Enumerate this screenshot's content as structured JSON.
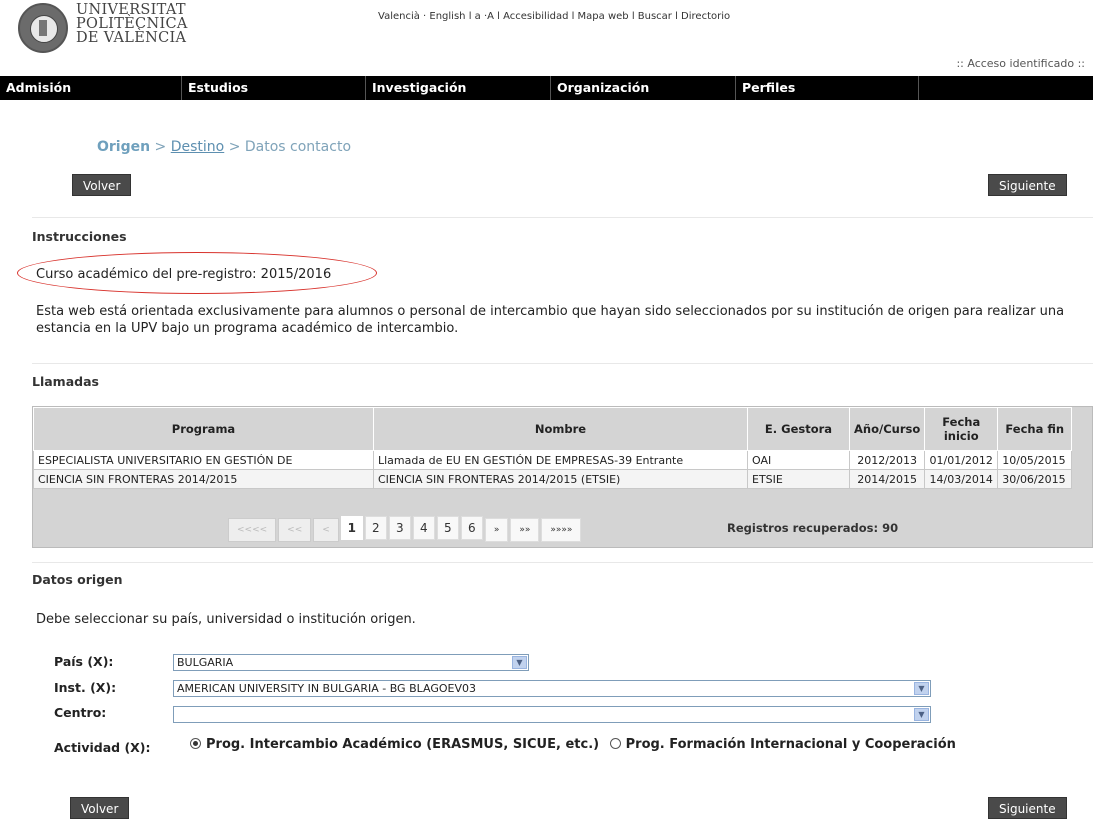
{
  "header": {
    "logo_lines": [
      "UNIVERSITAT",
      "POLITÈCNICA",
      "DE VALÈNCIA"
    ],
    "top_links": "Valencià · English l  a ·A  l  Accesibilidad  l  Mapa web  l  Buscar  l  Directorio",
    "access": ":: Acceso identificado ::"
  },
  "nav": [
    "Admisión",
    "Estudios",
    "Investigación",
    "Organización",
    "Perfiles"
  ],
  "breadcrumb": {
    "current": "Origen",
    "sep": " > ",
    "link": "Destino",
    "last": "Datos contacto"
  },
  "buttons": {
    "back": "Volver",
    "next": "Siguiente"
  },
  "instructions": {
    "title": "Instrucciones",
    "course": "Curso académico del pre-registro: 2015/2016",
    "text": "Esta web está orientada exclusivamente para alumnos o personal de intercambio que hayan sido seleccionados por su institución de origen para realizar una estancia en la UPV bajo un programa académico de intercambio."
  },
  "calls": {
    "title": "Llamadas",
    "columns": [
      "Programa",
      "Nombre",
      "E. Gestora",
      "Año/Curso",
      "Fecha inicio",
      "Fecha fin"
    ],
    "rows": [
      [
        "ESPECIALISTA UNIVERSITARIO EN GESTIÓN DE",
        "Llamada de EU EN GESTIÓN DE EMPRESAS-39 Entrante",
        "OAI",
        "2012/2013",
        "01/01/2012",
        "10/05/2015"
      ],
      [
        "CIENCIA SIN FRONTERAS 2014/2015",
        "CIENCIA SIN FRONTERAS 2014/2015 (ETSIE)",
        "ETSIE",
        "2014/2015",
        "14/03/2014",
        "30/06/2015"
      ]
    ],
    "pager": {
      "first": "<<<<",
      "prev2": "<<",
      "prev": "<",
      "pages": [
        "1",
        "2",
        "3",
        "4",
        "5",
        "6"
      ],
      "next": "»",
      "next2": "»»",
      "last": "»»»»"
    },
    "records": "Registros recuperados: 90"
  },
  "origin": {
    "title": "Datos origen",
    "hint": "Debe seleccionar su país, universidad o institución origen.",
    "pais_label": "País (X):",
    "pais_value": "BULGARIA",
    "inst_label": "Inst. (X):",
    "inst_value": "AMERICAN UNIVERSITY IN BULGARIA - BG BLAGOEV03",
    "centro_label": "Centro:",
    "centro_value": "",
    "actividad_label": "Actividad (X):",
    "actividad_options": [
      "Prog. Intercambio Académico (ERASMUS, SICUE, etc.)",
      "Prog. Formación Internacional y Cooperación"
    ]
  },
  "colors": {
    "nav_bg": "#000000",
    "accent_link": "#5d8fb0",
    "highlight_ellipse": "#d8322c"
  }
}
